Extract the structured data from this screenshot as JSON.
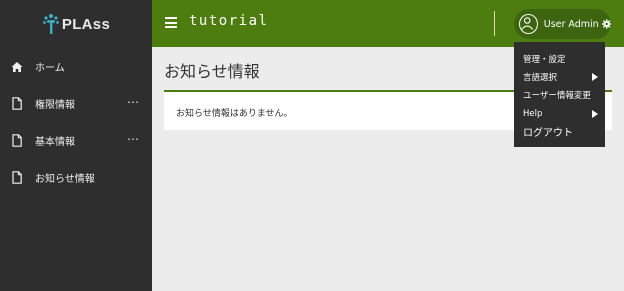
{
  "brand": {
    "name": "PLAss",
    "accent": "#4d7c0f",
    "sidebar_bg": "#2e2e2e",
    "logo_color": "#3ab0c4"
  },
  "header": {
    "title": "tutorial",
    "user_name": "User Admin"
  },
  "sidebar": {
    "items": [
      {
        "label": "ホーム",
        "icon": "home-icon",
        "has_menu": false
      },
      {
        "label": "権限情報",
        "icon": "document-icon",
        "has_menu": true,
        "menu": "⋯"
      },
      {
        "label": "基本情報",
        "icon": "document-icon",
        "has_menu": true,
        "menu": "⋯"
      },
      {
        "label": "お知らせ情報",
        "icon": "document-icon",
        "has_menu": false
      }
    ]
  },
  "main": {
    "title": "お知らせ情報",
    "empty_message": "お知らせ情報はありません。"
  },
  "user_menu": {
    "items": [
      {
        "label": "管理・設定",
        "submenu": false
      },
      {
        "label": "言語選択",
        "submenu": true
      },
      {
        "label": "ユーザー情報変更",
        "submenu": false
      },
      {
        "label": "Help",
        "submenu": true
      },
      {
        "label": "ログアウト",
        "submenu": false
      }
    ]
  }
}
